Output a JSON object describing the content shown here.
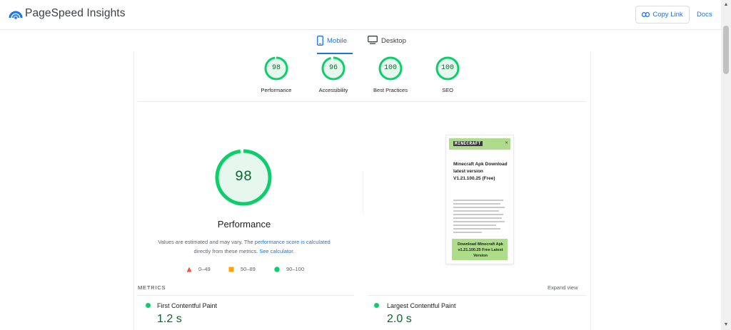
{
  "header": {
    "brand": "PageSpeed Insights",
    "copy_link": "Copy Link",
    "docs": "Docs"
  },
  "tabs": [
    {
      "label": "Mobile",
      "active": true
    },
    {
      "label": "Desktop",
      "active": false
    }
  ],
  "category_scores": [
    {
      "label": "Performance",
      "score": 98
    },
    {
      "label": "Accessibility",
      "score": 96
    },
    {
      "label": "Best Practices",
      "score": 100
    },
    {
      "label": "SEO",
      "score": 100
    }
  ],
  "performance": {
    "score": 98,
    "title": "Performance",
    "desc_1": "Values are estimated and may vary. The ",
    "link_1": "performance score is calculated",
    "desc_2": " directly from these metrics. ",
    "link_2": "See calculator."
  },
  "legend": [
    {
      "range": "0–49",
      "shape": "triangle",
      "color": "#ff4e42"
    },
    {
      "range": "50–89",
      "shape": "square",
      "color": "#ffa400"
    },
    {
      "range": "90–100",
      "shape": "circle",
      "color": "#0cce6b"
    }
  ],
  "screenshot": {
    "logo": "MINECRAFT",
    "title": "Minecraft Apk Download latest version V1.21.100.25 (Free)",
    "cta": "Download Minecraft Apk v1.21.100.25 Free Latest Version"
  },
  "metrics": {
    "heading": "METRICS",
    "expand": "Expand view",
    "items": [
      {
        "name": "First Contentful Paint",
        "value": "1.2 s"
      },
      {
        "name": "Largest Contentful Paint",
        "value": "2.0 s"
      }
    ]
  },
  "colors": {
    "accent": "#1a73e8",
    "pass": "#0cce6b",
    "pass_text": "#0d652d",
    "pass_fill": "#e6f8ee"
  }
}
